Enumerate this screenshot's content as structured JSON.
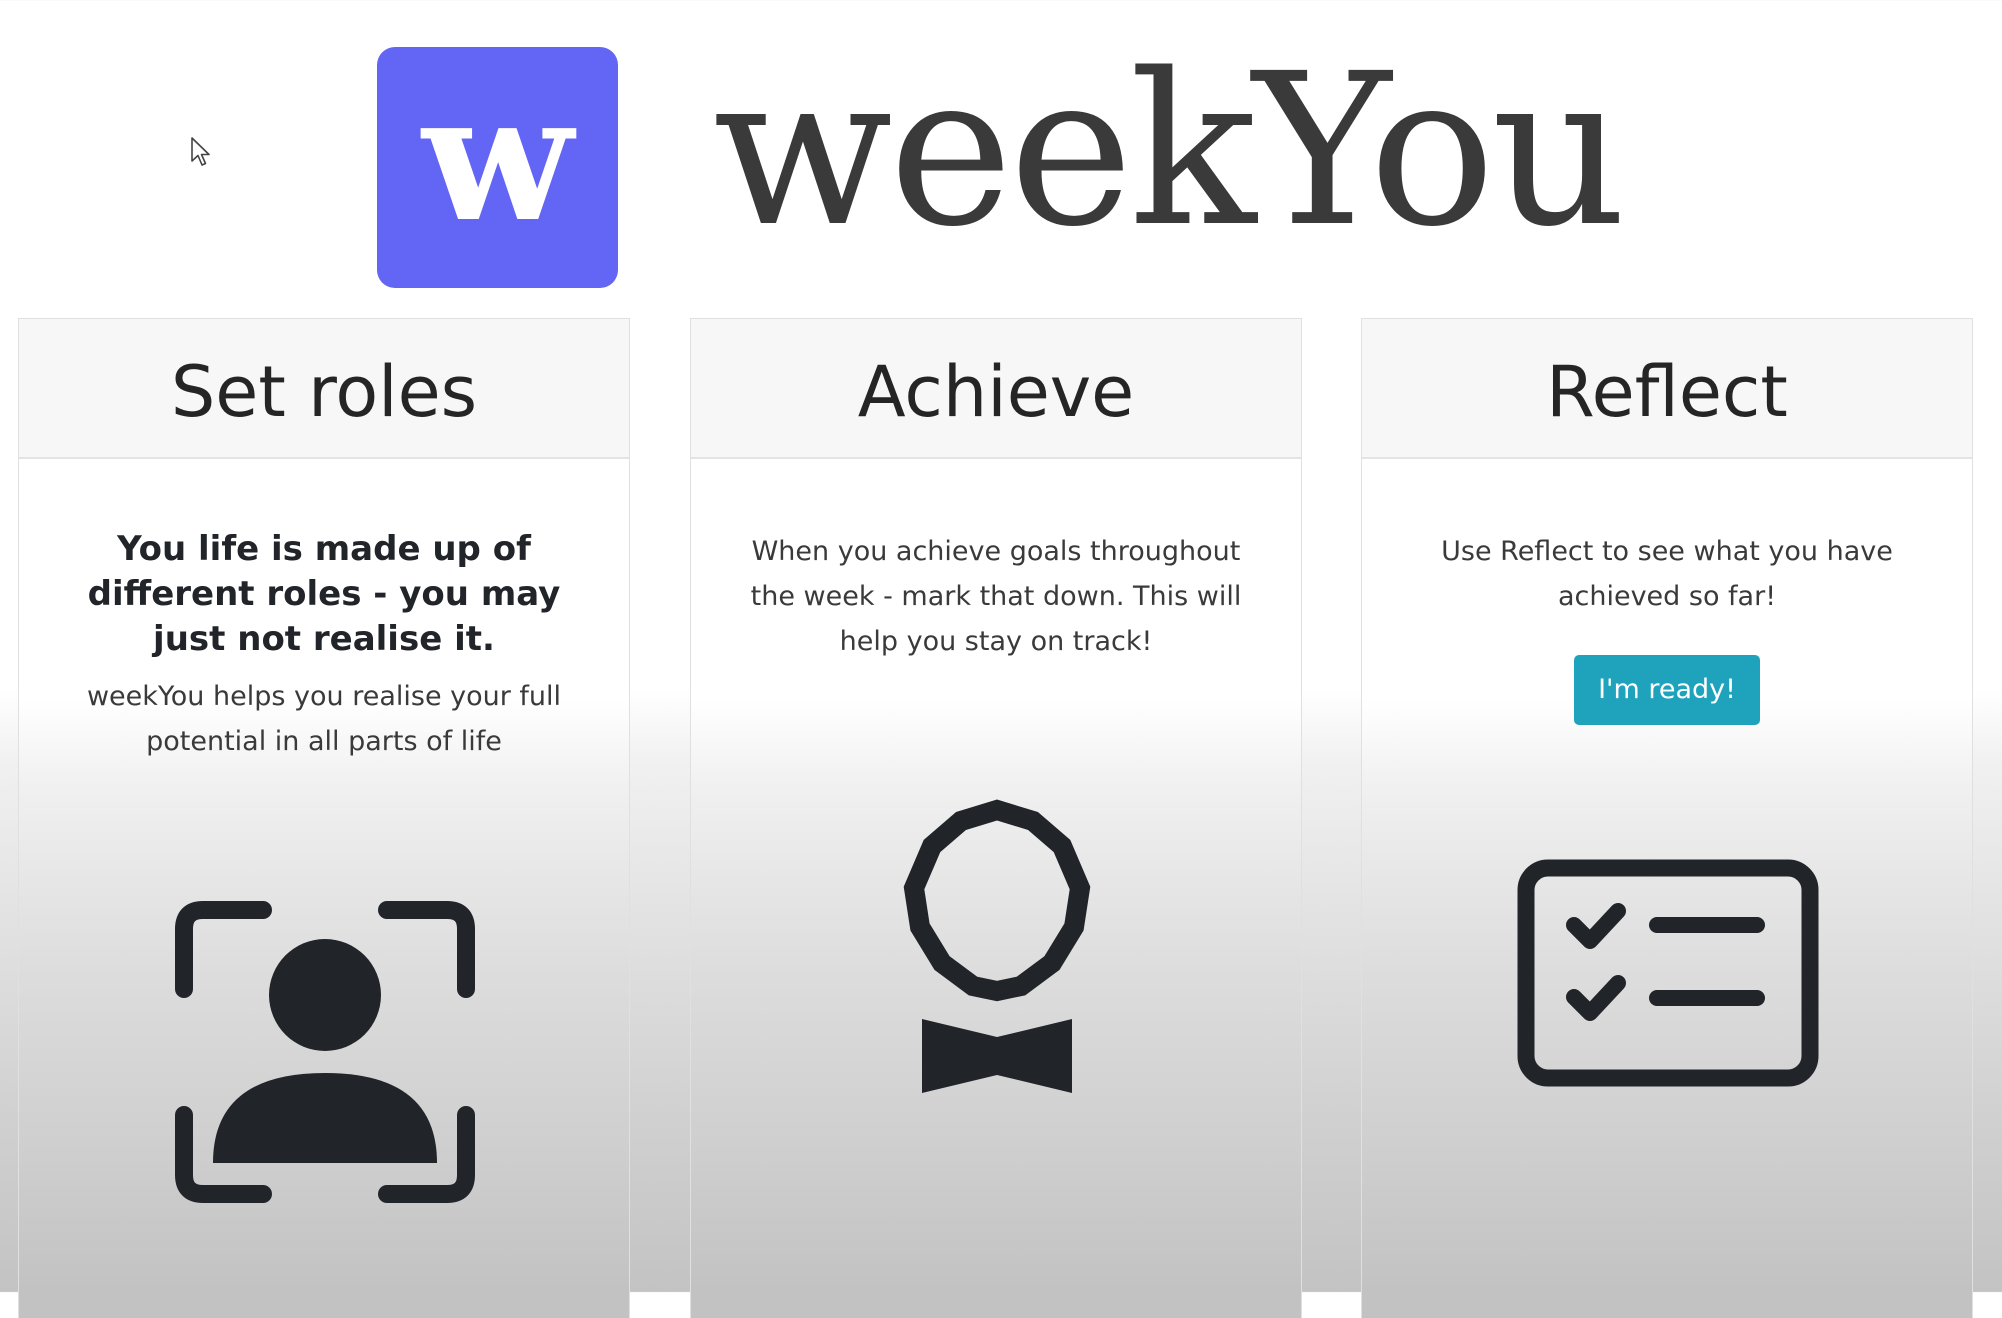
{
  "brand": {
    "logo_letter": "w",
    "name": "weekYou",
    "logo_color": "#6366f5"
  },
  "cards": [
    {
      "title": "Set roles",
      "lead": "You life is made up of different roles - you may just not realise it.",
      "text": "weekYou helps you realise your full potential in all parts of life",
      "icon": "person-focus-icon"
    },
    {
      "title": "Achieve",
      "text": "When you achieve goals throughout the week - mark that down. This will help you stay on track!",
      "icon": "award-badge-icon"
    },
    {
      "title": "Reflect",
      "text": "Use Reflect to see what you have achieved so far!",
      "button_label": "I'm ready!",
      "button_color": "#1fa3bd",
      "icon": "checklist-card-icon"
    }
  ]
}
